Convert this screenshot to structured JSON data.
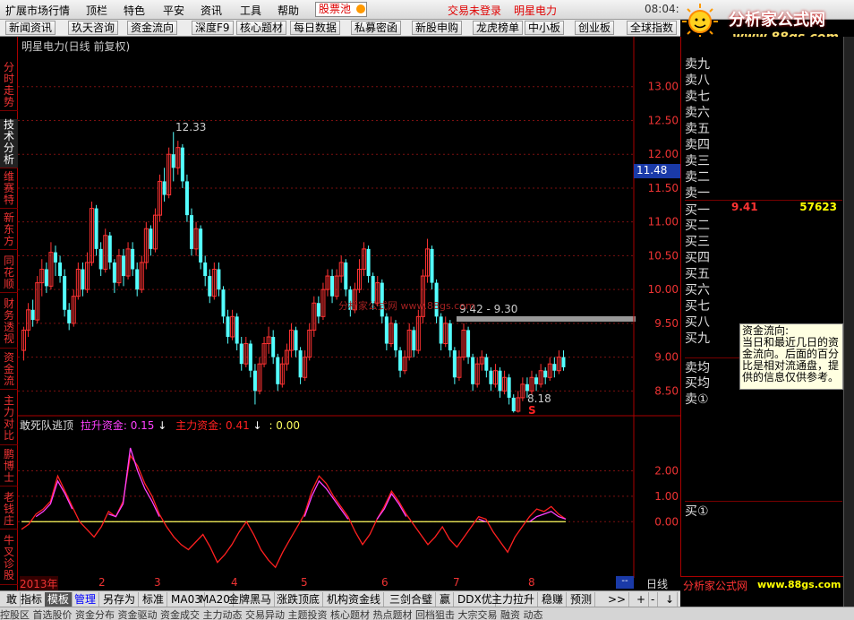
{
  "menu": {
    "items": [
      "扩展市场行情",
      "顶栏",
      "特色",
      "平安",
      "资讯",
      "工具",
      "帮助"
    ],
    "stock_pool": "股票池",
    "trade_status": "交易未登录",
    "stock_name": "明星电力",
    "clock": "08:04:"
  },
  "logo": {
    "brand": "分析家公式网",
    "url": "www.88gs.com"
  },
  "toolbar": {
    "items": [
      "新闻资讯",
      "玖天咨询",
      "资金流向",
      "深度F9",
      "核心题材",
      "每日数据",
      "私募密函",
      "新股申购",
      "龙虎榜单",
      "中小板",
      "创业板",
      "全球指数"
    ]
  },
  "left_tabs": [
    "分时走势",
    "技术分析",
    "维赛特",
    "新东方",
    "同花顺",
    "财务透视",
    "资金流",
    "主力对比",
    "鹏博士",
    "老钱庄",
    "牛叉诊股"
  ],
  "chart": {
    "title": "明星电力(日线 前复权)",
    "current_price_tag": "11.48",
    "high_label": "12.33",
    "low_label": "8.18",
    "range_label": "9.42 - 9.30",
    "watermark": "分析家公式网 www.88gs.com",
    "signal_label": "S",
    "price_ticks": [
      "13.00",
      "12.50",
      "12.00",
      "11.50",
      "11.00",
      "10.50",
      "10.00",
      "9.50",
      "9.00",
      "8.50"
    ],
    "indicator_ticks": [
      "2.00",
      "1.00",
      "0.00"
    ],
    "period_label": "日线",
    "time_labels": [
      "2013年",
      "2",
      "3",
      "4",
      "5",
      "6",
      "7",
      "8"
    ]
  },
  "indicator": {
    "name": "敢死队逃顶",
    "line1_label": "拉升资金: 0.15",
    "line2_label": "主力资金: 0.41",
    "line3_label": ": 0.00",
    "arrow": "↓"
  },
  "colors": {
    "up": "#ff3232",
    "down": "#54ffff",
    "line_red": "#ff2020",
    "line_magenta": "#ff40ff",
    "line_yellow": "#ffff60",
    "accent": "#e00000"
  },
  "chart_data": {
    "type": "candlestick",
    "ylim": [
      8.2,
      13.5
    ],
    "candles": [
      [
        9.1,
        9.4,
        8.95,
        9.45
      ],
      [
        9.4,
        9.7,
        9.3,
        9.8
      ],
      [
        9.7,
        9.55,
        9.45,
        9.85
      ],
      [
        9.55,
        10.1,
        9.5,
        10.2
      ],
      [
        10.1,
        10.3,
        9.9,
        10.45
      ],
      [
        10.3,
        10.05,
        9.95,
        10.4
      ],
      [
        10.05,
        10.55,
        10.0,
        10.7
      ],
      [
        10.55,
        10.4,
        10.2,
        10.65
      ],
      [
        10.4,
        10.2,
        10.1,
        10.5
      ],
      [
        10.2,
        9.7,
        9.6,
        10.3
      ],
      [
        9.7,
        9.5,
        9.4,
        9.8
      ],
      [
        9.5,
        9.9,
        9.45,
        10.0
      ],
      [
        9.9,
        10.3,
        9.85,
        10.4
      ],
      [
        10.3,
        10.0,
        9.9,
        10.4
      ],
      [
        10.0,
        10.4,
        9.95,
        10.55
      ],
      [
        10.4,
        11.2,
        10.35,
        11.3
      ],
      [
        11.2,
        10.6,
        10.5,
        11.25
      ],
      [
        10.6,
        10.3,
        10.2,
        10.7
      ],
      [
        10.3,
        10.8,
        10.25,
        10.9
      ],
      [
        10.8,
        10.4,
        10.3,
        10.85
      ],
      [
        10.4,
        10.1,
        9.95,
        10.45
      ],
      [
        10.1,
        10.5,
        10.05,
        10.6
      ],
      [
        10.5,
        10.2,
        10.05,
        10.6
      ],
      [
        10.2,
        10.6,
        10.15,
        10.7
      ],
      [
        10.6,
        10.3,
        10.2,
        10.7
      ],
      [
        10.3,
        10.0,
        9.9,
        10.4
      ],
      [
        10.0,
        10.4,
        9.95,
        10.5
      ],
      [
        10.4,
        10.9,
        10.3,
        11.0
      ],
      [
        10.9,
        10.6,
        10.5,
        10.95
      ],
      [
        10.6,
        11.1,
        10.55,
        11.2
      ],
      [
        11.1,
        11.6,
        11.0,
        11.7
      ],
      [
        11.6,
        11.4,
        11.3,
        11.8
      ],
      [
        11.4,
        12.0,
        11.35,
        12.1
      ],
      [
        12.0,
        11.8,
        11.6,
        12.33
      ],
      [
        11.8,
        12.1,
        11.7,
        12.2
      ],
      [
        12.1,
        11.6,
        11.5,
        12.15
      ],
      [
        11.6,
        11.1,
        11.0,
        11.7
      ],
      [
        11.1,
        10.6,
        10.5,
        11.2
      ],
      [
        10.6,
        10.9,
        10.5,
        11.0
      ],
      [
        10.9,
        10.4,
        10.3,
        10.95
      ],
      [
        10.4,
        10.2,
        10.05,
        10.5
      ],
      [
        10.2,
        9.9,
        9.8,
        10.3
      ],
      [
        9.9,
        10.3,
        9.85,
        10.4
      ],
      [
        10.3,
        10.0,
        9.9,
        10.4
      ],
      [
        10.0,
        9.6,
        9.5,
        10.05
      ],
      [
        9.6,
        9.3,
        9.2,
        9.7
      ],
      [
        9.3,
        9.6,
        9.25,
        9.7
      ],
      [
        9.6,
        9.2,
        9.1,
        9.65
      ],
      [
        9.2,
        8.9,
        8.8,
        9.3
      ],
      [
        8.9,
        9.2,
        8.85,
        9.3
      ],
      [
        9.2,
        8.8,
        8.7,
        9.25
      ],
      [
        8.8,
        8.5,
        8.3,
        8.9
      ],
      [
        8.5,
        8.9,
        8.45,
        9.0
      ],
      [
        8.9,
        9.2,
        8.85,
        9.3
      ],
      [
        9.2,
        9.3,
        9.05,
        9.45
      ],
      [
        9.3,
        9.0,
        8.9,
        9.4
      ],
      [
        9.0,
        8.6,
        8.5,
        9.05
      ],
      [
        8.6,
        8.9,
        8.55,
        9.0
      ],
      [
        8.9,
        9.1,
        8.8,
        9.2
      ],
      [
        9.1,
        9.4,
        9.0,
        9.5
      ],
      [
        9.4,
        9.1,
        9.0,
        9.45
      ],
      [
        9.1,
        8.7,
        8.6,
        9.15
      ],
      [
        8.7,
        9.0,
        8.65,
        9.1
      ],
      [
        9.0,
        9.4,
        8.95,
        9.5
      ],
      [
        9.4,
        9.8,
        9.3,
        9.9
      ],
      [
        9.8,
        9.6,
        9.5,
        9.9
      ],
      [
        9.6,
        10.0,
        9.55,
        10.1
      ],
      [
        10.0,
        10.2,
        9.9,
        10.3
      ],
      [
        10.2,
        9.9,
        9.8,
        10.3
      ],
      [
        9.9,
        10.2,
        9.85,
        10.3
      ],
      [
        10.2,
        10.4,
        10.1,
        10.5
      ],
      [
        10.4,
        10.0,
        9.9,
        10.45
      ],
      [
        10.0,
        9.7,
        9.6,
        10.05
      ],
      [
        9.7,
        10.0,
        9.65,
        10.1
      ],
      [
        10.0,
        10.3,
        9.95,
        10.45
      ],
      [
        10.3,
        10.6,
        10.2,
        10.7
      ],
      [
        10.6,
        10.2,
        10.1,
        10.65
      ],
      [
        10.2,
        9.8,
        9.7,
        10.25
      ],
      [
        9.8,
        10.1,
        9.75,
        10.2
      ],
      [
        10.1,
        9.6,
        9.5,
        10.15
      ],
      [
        9.6,
        9.2,
        9.1,
        9.65
      ],
      [
        9.2,
        9.5,
        9.15,
        9.6
      ],
      [
        9.5,
        9.1,
        9.0,
        9.55
      ],
      [
        9.1,
        8.8,
        8.7,
        9.15
      ],
      [
        8.8,
        9.0,
        8.75,
        9.1
      ],
      [
        9.0,
        9.4,
        8.95,
        9.5
      ],
      [
        9.4,
        9.1,
        9.0,
        9.45
      ],
      [
        9.1,
        9.6,
        9.05,
        9.7
      ],
      [
        9.6,
        10.2,
        9.5,
        10.3
      ],
      [
        10.2,
        10.6,
        10.1,
        10.75
      ],
      [
        10.6,
        10.1,
        10.0,
        10.65
      ],
      [
        10.1,
        9.6,
        9.5,
        10.15
      ],
      [
        9.6,
        9.2,
        9.1,
        9.65
      ],
      [
        9.2,
        9.5,
        9.15,
        9.6
      ],
      [
        9.5,
        9.1,
        9.0,
        9.55
      ],
      [
        9.1,
        8.7,
        8.6,
        9.15
      ],
      [
        8.7,
        9.0,
        8.65,
        9.1
      ],
      [
        9.0,
        9.4,
        8.95,
        9.5
      ],
      [
        9.4,
        9.0,
        8.9,
        9.45
      ],
      [
        9.0,
        8.6,
        8.5,
        9.05
      ],
      [
        8.6,
        8.9,
        8.55,
        9.0
      ],
      [
        8.9,
        9.0,
        8.8,
        9.1
      ],
      [
        9.0,
        8.8,
        8.7,
        9.05
      ],
      [
        8.8,
        8.6,
        8.5,
        8.85
      ],
      [
        8.6,
        8.8,
        8.55,
        8.9
      ],
      [
        8.8,
        8.5,
        8.4,
        8.85
      ],
      [
        8.5,
        8.7,
        8.45,
        8.8
      ],
      [
        8.7,
        8.4,
        8.3,
        8.75
      ],
      [
        8.4,
        8.2,
        8.18,
        8.45
      ],
      [
        8.2,
        8.4,
        8.18,
        8.5
      ],
      [
        8.4,
        8.6,
        8.35,
        8.7
      ],
      [
        8.6,
        8.5,
        8.4,
        8.7
      ],
      [
        8.5,
        8.7,
        8.45,
        8.8
      ],
      [
        8.7,
        8.6,
        8.5,
        8.75
      ],
      [
        8.6,
        8.8,
        8.55,
        8.9
      ],
      [
        8.8,
        8.7,
        8.6,
        8.85
      ],
      [
        8.7,
        8.9,
        8.65,
        9.0
      ],
      [
        8.9,
        8.8,
        8.7,
        9.0
      ],
      [
        8.8,
        9.0,
        8.75,
        9.1
      ],
      [
        9.0,
        8.85,
        8.8,
        9.1
      ]
    ],
    "indicator_ylim": [
      -2.0,
      3.5
    ],
    "line_red": [
      -0.3,
      -0.1,
      0.3,
      0.5,
      0.8,
      1.8,
      1.2,
      0.6,
      0.0,
      -0.3,
      -0.6,
      -0.2,
      0.4,
      0.2,
      0.8,
      2.6,
      2.2,
      1.5,
      1.0,
      0.3,
      -0.2,
      -0.6,
      -0.9,
      -1.1,
      -0.8,
      -0.5,
      -1.0,
      -1.6,
      -1.3,
      -0.9,
      -0.4,
      0.0,
      -0.5,
      -1.1,
      -1.5,
      -1.8,
      -1.2,
      -0.7,
      -0.2,
      0.3,
      1.2,
      1.8,
      1.5,
      1.0,
      0.6,
      0.2,
      -0.4,
      -0.9,
      -0.5,
      0.1,
      0.6,
      1.2,
      0.8,
      0.3,
      -0.1,
      -0.5,
      -0.9,
      -0.6,
      -0.2,
      -0.7,
      -1.0,
      -0.6,
      -0.2,
      0.2,
      0.1,
      -0.4,
      -0.8,
      -1.2,
      -0.6,
      -0.2,
      0.2,
      0.5,
      0.4,
      0.6,
      0.3,
      0.1
    ],
    "line_magenta": [
      null,
      null,
      0.2,
      0.4,
      0.7,
      1.6,
      1.1,
      0.5,
      null,
      null,
      null,
      null,
      0.3,
      0.2,
      0.7,
      2.9,
      2.0,
      1.3,
      0.8,
      0.2,
      null,
      null,
      null,
      null,
      null,
      null,
      null,
      null,
      null,
      null,
      null,
      null,
      null,
      null,
      null,
      null,
      null,
      null,
      null,
      0.2,
      1.0,
      1.6,
      1.3,
      0.9,
      0.5,
      0.1,
      null,
      null,
      null,
      0.1,
      0.5,
      1.1,
      0.7,
      0.2,
      null,
      null,
      null,
      null,
      null,
      null,
      null,
      null,
      null,
      0.1,
      0.0,
      null,
      null,
      null,
      null,
      null,
      0.0,
      0.2,
      0.3,
      0.4,
      0.2,
      0.1
    ]
  },
  "order_book": {
    "sell": [
      "卖九",
      "卖八",
      "卖七",
      "卖六",
      "卖五",
      "卖四",
      "卖三",
      "卖二",
      "卖一"
    ],
    "buy": [
      "买一",
      "买二",
      "买三",
      "买四",
      "买五",
      "买六",
      "买七",
      "买八",
      "买九"
    ],
    "buy1_price": "9.41",
    "buy1_volume": "57623",
    "extra": [
      "卖均",
      "买均",
      "卖①"
    ],
    "lower_label": "买①"
  },
  "popup": {
    "title": "资金流向:",
    "text": "当日和最近几日的资金流向。后面的百分比是相对流通盘，提供的信息仅供参考。"
  },
  "right_bottom": {
    "brand": "分析家公式网",
    "url": "www.88gs.com"
  },
  "bottom_tabs": [
    "敢",
    "指标",
    "模板",
    "管理",
    "另存为",
    "标准",
    "MA03",
    "MA20",
    "金牌黑马",
    "涨跌顶底",
    "机构资金线",
    "三剑合璧",
    "赢",
    "DDX优",
    "主力拉升",
    "稳赚",
    "预测",
    ">>"
  ],
  "bottom_extra": [
    "+",
    "-",
    "↓"
  ],
  "status_text": "控股区  首选股价  资金分布  资金驱动  资金成交  主力动态  交易异动  主题投资  核心题材  热点题材  回档狙击  大宗交易  融资  动态"
}
